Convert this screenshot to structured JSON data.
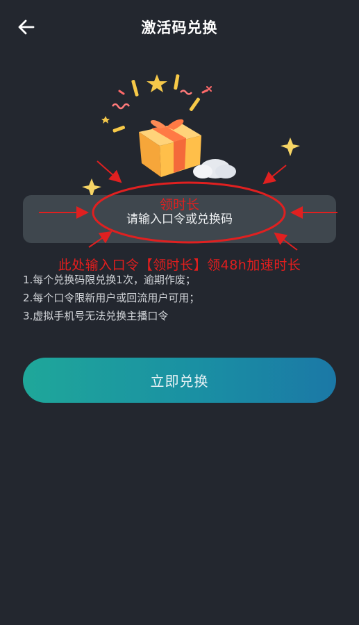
{
  "header": {
    "title": "激活码兑换",
    "back_icon": "arrow-left-icon"
  },
  "input": {
    "placeholder": "请输入口令或兑换码",
    "value": ""
  },
  "annotations": {
    "top_label": "领时长",
    "bottom_label": "此处输入口令【领时长】领48h加速时长",
    "color": "#e02020"
  },
  "rules": [
    "1.每个兑换码限兑换1次，逾期作废；",
    "2.每个口令限新用户或回流用户可用；",
    "3.虚拟手机号无法兑换主播口令"
  ],
  "redeem_button": {
    "label": "立即兑换"
  },
  "colors": {
    "background": "#23272f",
    "input_bg": "#3f474e",
    "button_gradient_start": "#1fa79a",
    "button_gradient_end": "#1b78a6"
  }
}
